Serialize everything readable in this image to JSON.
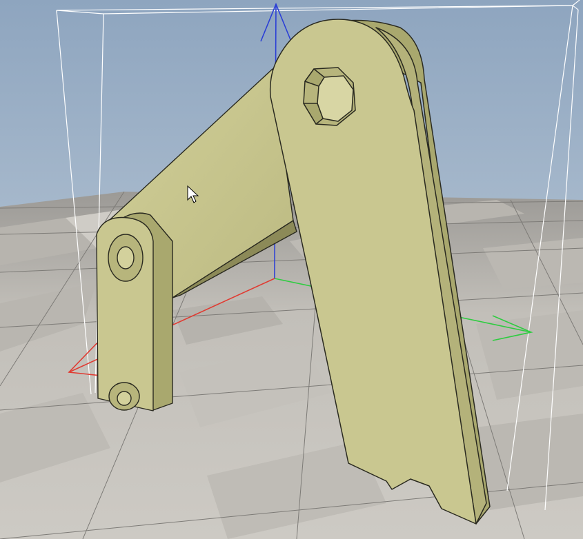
{
  "viewport": {
    "scene": "3d-viewport",
    "background": {
      "sky_top": "#8ea5bf",
      "sky_bottom": "#a7b9cc",
      "floor_light": "#c9c6c0",
      "floor_dark": "#b4b1ab",
      "floor_lines": "#7d7b77"
    },
    "model": {
      "color": "#c9c790",
      "shade": "#a9a86e",
      "dark": "#8c8a58",
      "outline": "#2a2a20"
    },
    "bounding_box_color": "#ffffff",
    "axes": {
      "x": {
        "color": "#e03b32"
      },
      "y": {
        "color": "#2ecc40"
      },
      "z": {
        "color": "#2b3fd6"
      }
    },
    "cursor": {
      "icon": "arrow-cursor-icon"
    }
  }
}
